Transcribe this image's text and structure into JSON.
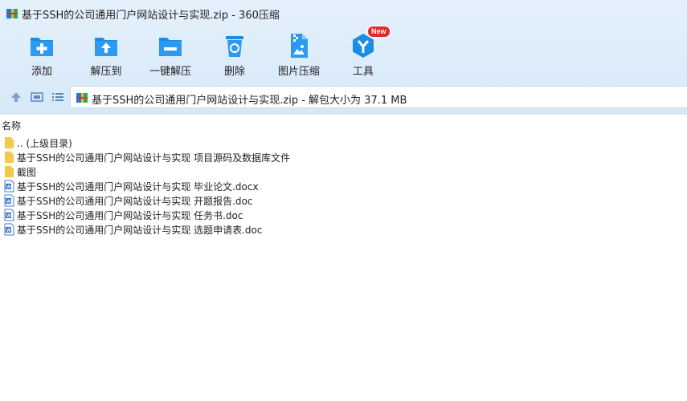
{
  "window": {
    "title": "基于SSH的公司通用门户网站设计与实现.zip - 360压缩",
    "icon": "zip-archive-icon"
  },
  "toolbar": {
    "add": {
      "label": "添加",
      "icon": "add-folder-icon"
    },
    "extract_to": {
      "label": "解压到",
      "icon": "extract-folder-icon"
    },
    "one_click_extract": {
      "label": "一键解压",
      "icon": "one-click-extract-icon"
    },
    "delete": {
      "label": "删除",
      "icon": "recycle-bin-icon"
    },
    "image_compress": {
      "label": "图片压缩",
      "icon": "image-compress-icon"
    },
    "tools": {
      "label": "工具",
      "icon": "tools-icon",
      "badge": "New"
    }
  },
  "navigation": {
    "up_icon": "up-arrow-icon",
    "view_thumbnail_icon": "thumbnail-view-icon",
    "view_list_icon": "list-view-icon",
    "address": "基于SSH的公司通用门户网站设计与实现.zip - 解包大小为 37.1 MB"
  },
  "columns": {
    "name": "名称"
  },
  "files": [
    {
      "name": ".. (上级目录)",
      "icon": "folder-icon"
    },
    {
      "name": "基于SSH的公司通用门户网站设计与实现 项目源码及数据库文件",
      "icon": "folder-icon"
    },
    {
      "name": "截图",
      "icon": "folder-icon"
    },
    {
      "name": "基于SSH的公司通用门户网站设计与实现 毕业论文.docx",
      "icon": "word-doc-icon"
    },
    {
      "name": "基于SSH的公司通用门户网站设计与实现 开题报告.doc",
      "icon": "word-doc-icon"
    },
    {
      "name": "基于SSH的公司通用门户网站设计与实现 任务书.doc",
      "icon": "word-doc-icon"
    },
    {
      "name": "基于SSH的公司通用门户网站设计与实现 选题申请表.doc",
      "icon": "word-doc-icon"
    }
  ],
  "colors": {
    "chrome_bg": "#dcebf9",
    "icon_blue": "#1a8ee3",
    "folder_yellow": "#f5c84c",
    "badge_red": "#e8262a"
  }
}
